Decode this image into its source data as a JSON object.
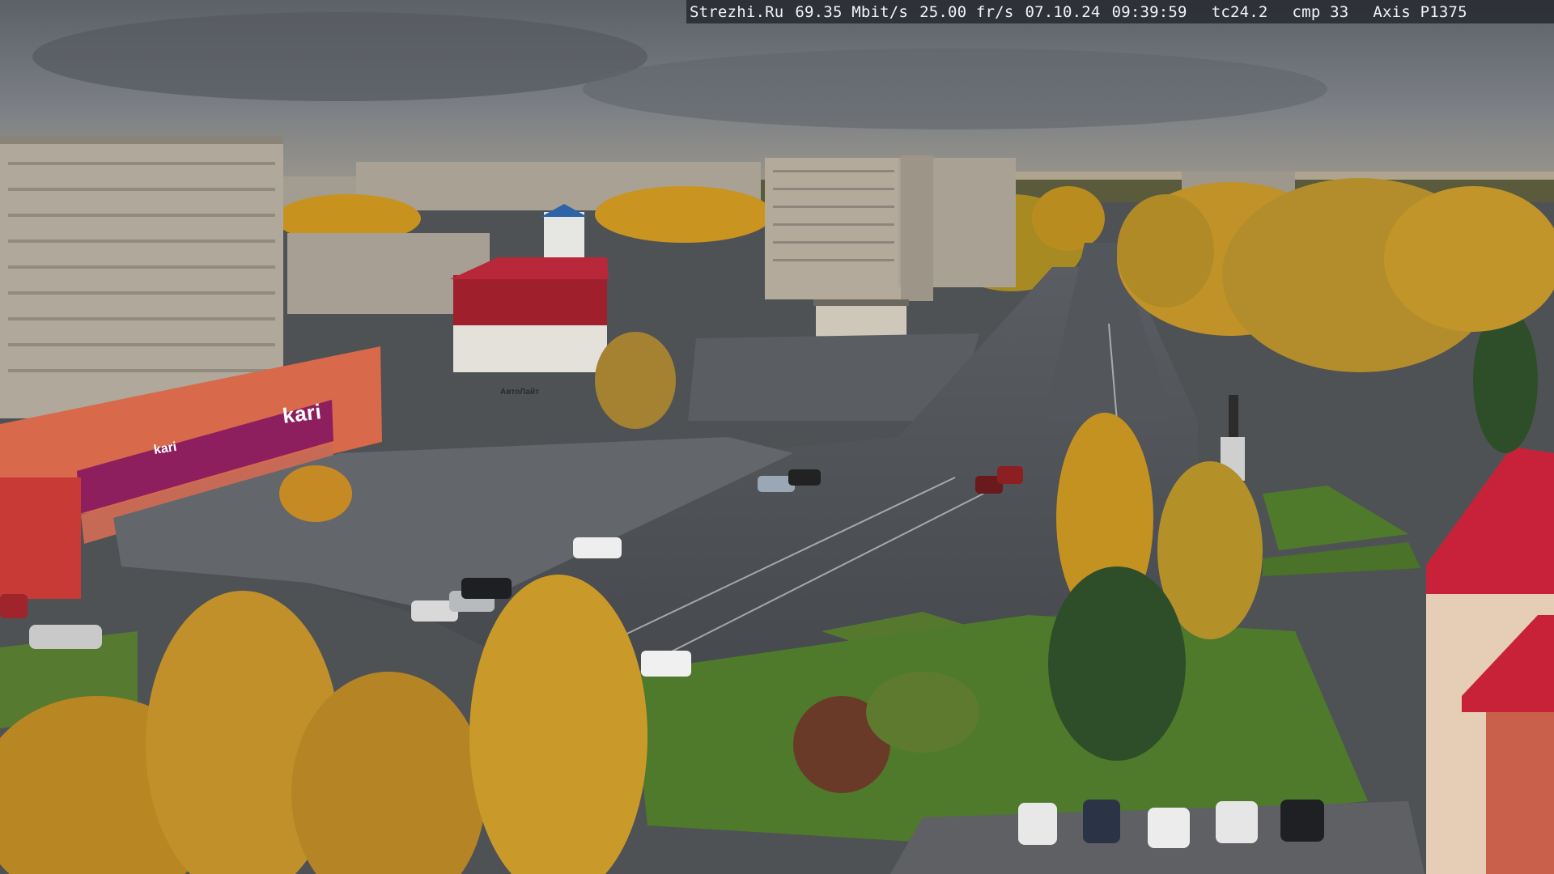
{
  "overlay": {
    "site": "Strezhi.Ru",
    "bitrate": "69.35 Mbit/s",
    "framerate": "25.00 fr/s",
    "date": "07.10.24",
    "time": "09:39:59",
    "timecode": "tc24.2",
    "compression": "cmp 33",
    "camera_model": "Axis P1375"
  },
  "signs": {
    "kari_main": "kari",
    "kari_secondary": "kari",
    "avtolend": "АвтоЛайт"
  },
  "colors": {
    "sky": "#6c7178",
    "kari_brand": "#8e1f5e",
    "autumn_foliage": "#c8921e",
    "grass": "#4f7a2c",
    "asphalt": "#4a4d52"
  }
}
